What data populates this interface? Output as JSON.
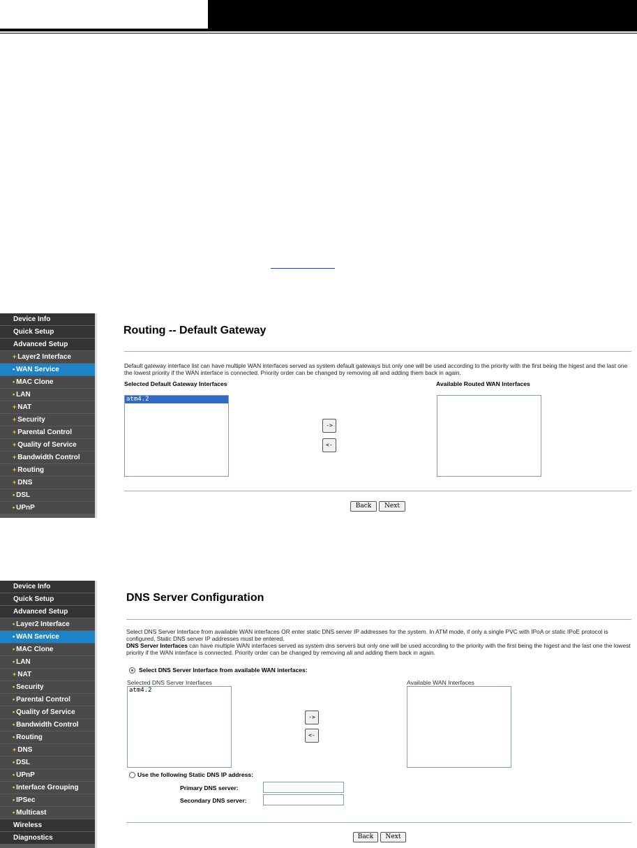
{
  "shot1": {
    "sidebar": [
      {
        "label": "Device Info",
        "kind": "top"
      },
      {
        "label": "Quick Setup",
        "kind": "top"
      },
      {
        "label": "Advanced Setup",
        "kind": "top"
      },
      {
        "label": "Layer2 Interface",
        "kind": "sub",
        "bullet": "+"
      },
      {
        "label": "WAN Service",
        "kind": "sub",
        "bullet": "•",
        "selected": true
      },
      {
        "label": "MAC Clone",
        "kind": "sub",
        "bullet": "•"
      },
      {
        "label": "LAN",
        "kind": "sub",
        "bullet": "•"
      },
      {
        "label": "NAT",
        "kind": "sub",
        "bullet": "+"
      },
      {
        "label": "Security",
        "kind": "sub",
        "bullet": "+"
      },
      {
        "label": "Parental Control",
        "kind": "sub",
        "bullet": "+"
      },
      {
        "label": "Quality of Service",
        "kind": "sub",
        "bullet": "+"
      },
      {
        "label": "Bandwidth Control",
        "kind": "sub",
        "bullet": "+"
      },
      {
        "label": "Routing",
        "kind": "sub",
        "bullet": "+"
      },
      {
        "label": "DNS",
        "kind": "sub",
        "bullet": "+"
      },
      {
        "label": "DSL",
        "kind": "sub",
        "bullet": "•"
      },
      {
        "label": "UPnP",
        "kind": "sub",
        "bullet": "•"
      }
    ],
    "title": "Routing -- Default Gateway",
    "description": "Default gateway interface list can have multiple WAN interfaces served as system default gateways but only one will be used according to the priority with the first being the higest and the last one the lowest priority if the WAN interface is connected. Priority order can be changed by removing all and adding them back in again.",
    "selected_label": "Selected Default Gateway Interfaces",
    "available_label": "Available Routed WAN Interfaces",
    "selected_items": [
      "atm4.2"
    ],
    "move_right": "->",
    "move_left": "<-",
    "back": "Back",
    "next": "Next"
  },
  "shot2": {
    "sidebar": [
      {
        "label": "Device Info",
        "kind": "top"
      },
      {
        "label": "Quick Setup",
        "kind": "top"
      },
      {
        "label": "Advanced Setup",
        "kind": "top"
      },
      {
        "label": "Layer2 Interface",
        "kind": "sub",
        "bullet": "•"
      },
      {
        "label": "WAN Service",
        "kind": "sub",
        "bullet": "•",
        "selected": true
      },
      {
        "label": "MAC Clone",
        "kind": "sub",
        "bullet": "•"
      },
      {
        "label": "LAN",
        "kind": "sub",
        "bullet": "•"
      },
      {
        "label": "NAT",
        "kind": "sub",
        "bullet": "+"
      },
      {
        "label": "Security",
        "kind": "sub",
        "bullet": "•"
      },
      {
        "label": "Parental Control",
        "kind": "sub",
        "bullet": "•"
      },
      {
        "label": "Quality of Service",
        "kind": "sub",
        "bullet": "•"
      },
      {
        "label": "Bandwidth Control",
        "kind": "sub",
        "bullet": "•"
      },
      {
        "label": "Routing",
        "kind": "sub",
        "bullet": "•"
      },
      {
        "label": "DNS",
        "kind": "sub",
        "bullet": "+"
      },
      {
        "label": "DSL",
        "kind": "sub",
        "bullet": "•"
      },
      {
        "label": "UPnP",
        "kind": "sub",
        "bullet": "•"
      },
      {
        "label": "Interface Grouping",
        "kind": "sub",
        "bullet": "•"
      },
      {
        "label": "IPSec",
        "kind": "sub",
        "bullet": "•"
      },
      {
        "label": "Multicast",
        "kind": "sub",
        "bullet": "•"
      },
      {
        "label": "Wireless",
        "kind": "top"
      },
      {
        "label": "Diagnostics",
        "kind": "top"
      }
    ],
    "title": "DNS Server Configuration",
    "desc1": "Select DNS Server Interface from available WAN interfaces OR enter static DNS server IP addresses for the system. In ATM mode, if only a single PVC with IPoA or static IPoE protocol is configured, Static DNS server IP addresses must be entered.",
    "desc2_bold": "DNS Server Interfaces",
    "desc2": " can have multiple WAN interfaces served as system dns servers but only one will be used according to the priority with the first being the higest and the last one the lowest priority if the WAN interface is connected. Priority order can be changed by removing all and adding them back in again.",
    "radio1_label": "Select DNS Server Interface from available WAN interfaces:",
    "selected_label": "Selected DNS Server Interfaces",
    "available_label": "Available WAN Interfaces",
    "selected_items": [
      "atm4.2"
    ],
    "move_right": "->",
    "move_left": "<-",
    "radio2_label": "Use the following Static DNS IP address:",
    "primary_label": "Primary DNS server:",
    "secondary_label": "Secondary DNS server:",
    "primary_value": "",
    "secondary_value": "",
    "back": "Back",
    "next": "Next"
  }
}
